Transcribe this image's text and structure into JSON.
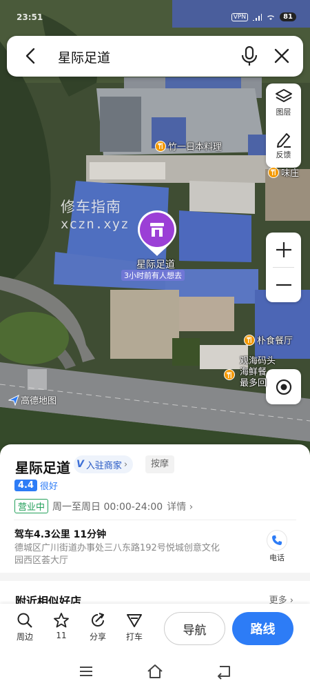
{
  "status_bar": {
    "time": "23:51",
    "vpn": "VPN",
    "battery": "81"
  },
  "search": {
    "query": "星际足道"
  },
  "map_controls": {
    "layers_label": "图层",
    "feedback_label": "反馈"
  },
  "map": {
    "watermark_line1": "修车指南",
    "watermark_line2": "xczn.xyz",
    "selected_place_label": "星际足道",
    "selected_place_tag": "3小时前有人想去",
    "provider_logo": "高德地图",
    "pois": [
      {
        "label": "竹一日本料理"
      },
      {
        "label": "味庄"
      },
      {
        "label": "朴食餐厅"
      },
      {
        "label": "观海码头"
      },
      {
        "label": "海鲜餐"
      },
      {
        "label": "最多回"
      }
    ]
  },
  "place": {
    "name": "星际足道",
    "merchant_badge": "入驻商家",
    "merchant_badge_icon": "V",
    "category": "按摩",
    "score": "4.4",
    "score_label": "很好",
    "status": "营业中",
    "hours": "周一至周日 00:00-24:00",
    "hours_detail": "详情",
    "drive_info": "驾车4.3公里 11分钟",
    "address": "德城区广川街道办事处三八东路192号悦城创意文化园西区荟大厅",
    "phone_label": "电话"
  },
  "similar": {
    "title": "附近相似好店",
    "more": "更多"
  },
  "actions": {
    "nearby": "周边",
    "favorites": "11",
    "share": "分享",
    "taxi": "打车",
    "navigate": "导航",
    "route": "路线"
  },
  "colors": {
    "brand_blue": "#2D7CF6",
    "pin_purple": "#9B3FD6",
    "open_green": "#23A05A",
    "poi_orange": "#F39800"
  }
}
